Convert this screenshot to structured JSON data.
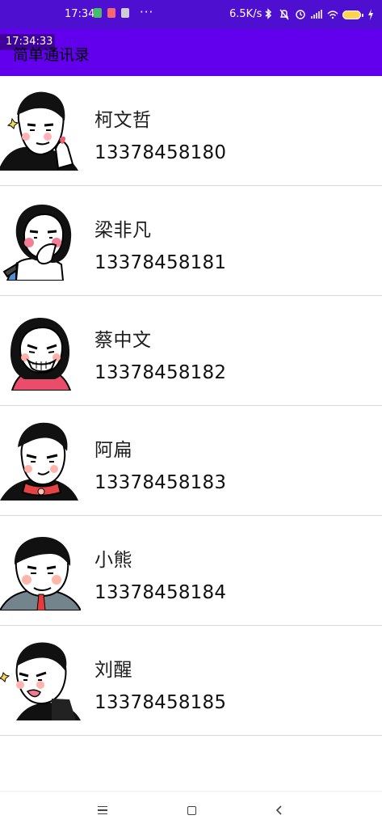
{
  "status_bar": {
    "time": "17:34",
    "more": "···",
    "speed": "6.5K/s",
    "battery_label": "battery-icon",
    "colors": {
      "background": "#4f0fd0",
      "text": "#ffffff",
      "battery": "#ffd34d"
    }
  },
  "overlay": {
    "time": "17:34:33"
  },
  "app_bar": {
    "title": "简单通讯录",
    "background": "#6200ee"
  },
  "contacts": [
    {
      "name": "柯文哲",
      "phone": "13378458180",
      "avatar": "cartoon-man-heart-gesture-avatar"
    },
    {
      "name": "梁非凡",
      "phone": "13378458181",
      "avatar": "cartoon-woman-surprised-avatar"
    },
    {
      "name": "蔡中文",
      "phone": "13378458182",
      "avatar": "cartoon-woman-smiling-avatar"
    },
    {
      "name": "阿扁",
      "phone": "13378458183",
      "avatar": "cartoon-man-red-collar-avatar"
    },
    {
      "name": "小熊",
      "phone": "13378458184",
      "avatar": "cartoon-old-man-avatar"
    },
    {
      "name": "刘醒",
      "phone": "13378458185",
      "avatar": "cartoon-man-tongue-avatar"
    }
  ],
  "nav_bar": {
    "menu_icon": "menu-icon",
    "home_icon": "home-icon",
    "back_icon": "back-icon"
  }
}
